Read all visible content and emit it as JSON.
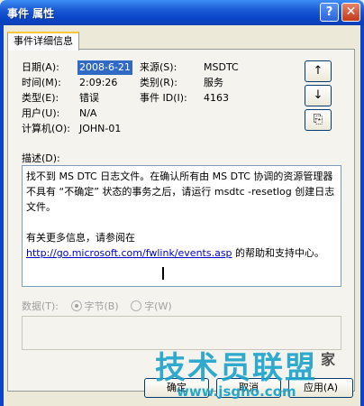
{
  "window": {
    "title": "事件 属性",
    "help_btn": "?",
    "close_btn": "✕"
  },
  "tab": {
    "label": "事件详细信息"
  },
  "fields": {
    "date_label": "日期(A):",
    "date_value": "2008-6-21",
    "source_label": "来源(S):",
    "source_value": "MSDTC",
    "time_label": "时间(M):",
    "time_value": "2:09:26",
    "category_label": "类别(R):",
    "category_value": "服务",
    "type_label": "类型(E):",
    "type_value": "错误",
    "event_id_label": "事件 ID(I):",
    "event_id_value": "4163",
    "user_label": "用户(U):",
    "user_value": "N/A",
    "computer_label": "计算机(O):",
    "computer_value": "JOHN-01"
  },
  "nav": {
    "up_icon": "↑",
    "down_icon": "↓",
    "copy_icon": "⎘"
  },
  "description": {
    "label": "描述(D):",
    "text1": "找不到 MS DTC 日志文件。在确认所有由 MS DTC 协调的资源管理器不具有 “不确定” 状态的事务之后，请运行 msdtc -resetlog 创建日志文件。",
    "text2": "有关更多信息，请参阅在",
    "link": "http://go.microsoft.com/fwlink/events.asp",
    "text3": " 的帮助和支持中心。"
  },
  "data": {
    "label": "数据(T):",
    "option_bytes": "字节(B)",
    "option_words": "字(W)",
    "selected": "字节(B)"
  },
  "buttons": {
    "ok": "确定",
    "cancel": "取消",
    "apply": "应用(A)"
  },
  "watermark": {
    "main": "技术员联盟",
    "side": "家",
    "url": "www.jsgho.com"
  }
}
